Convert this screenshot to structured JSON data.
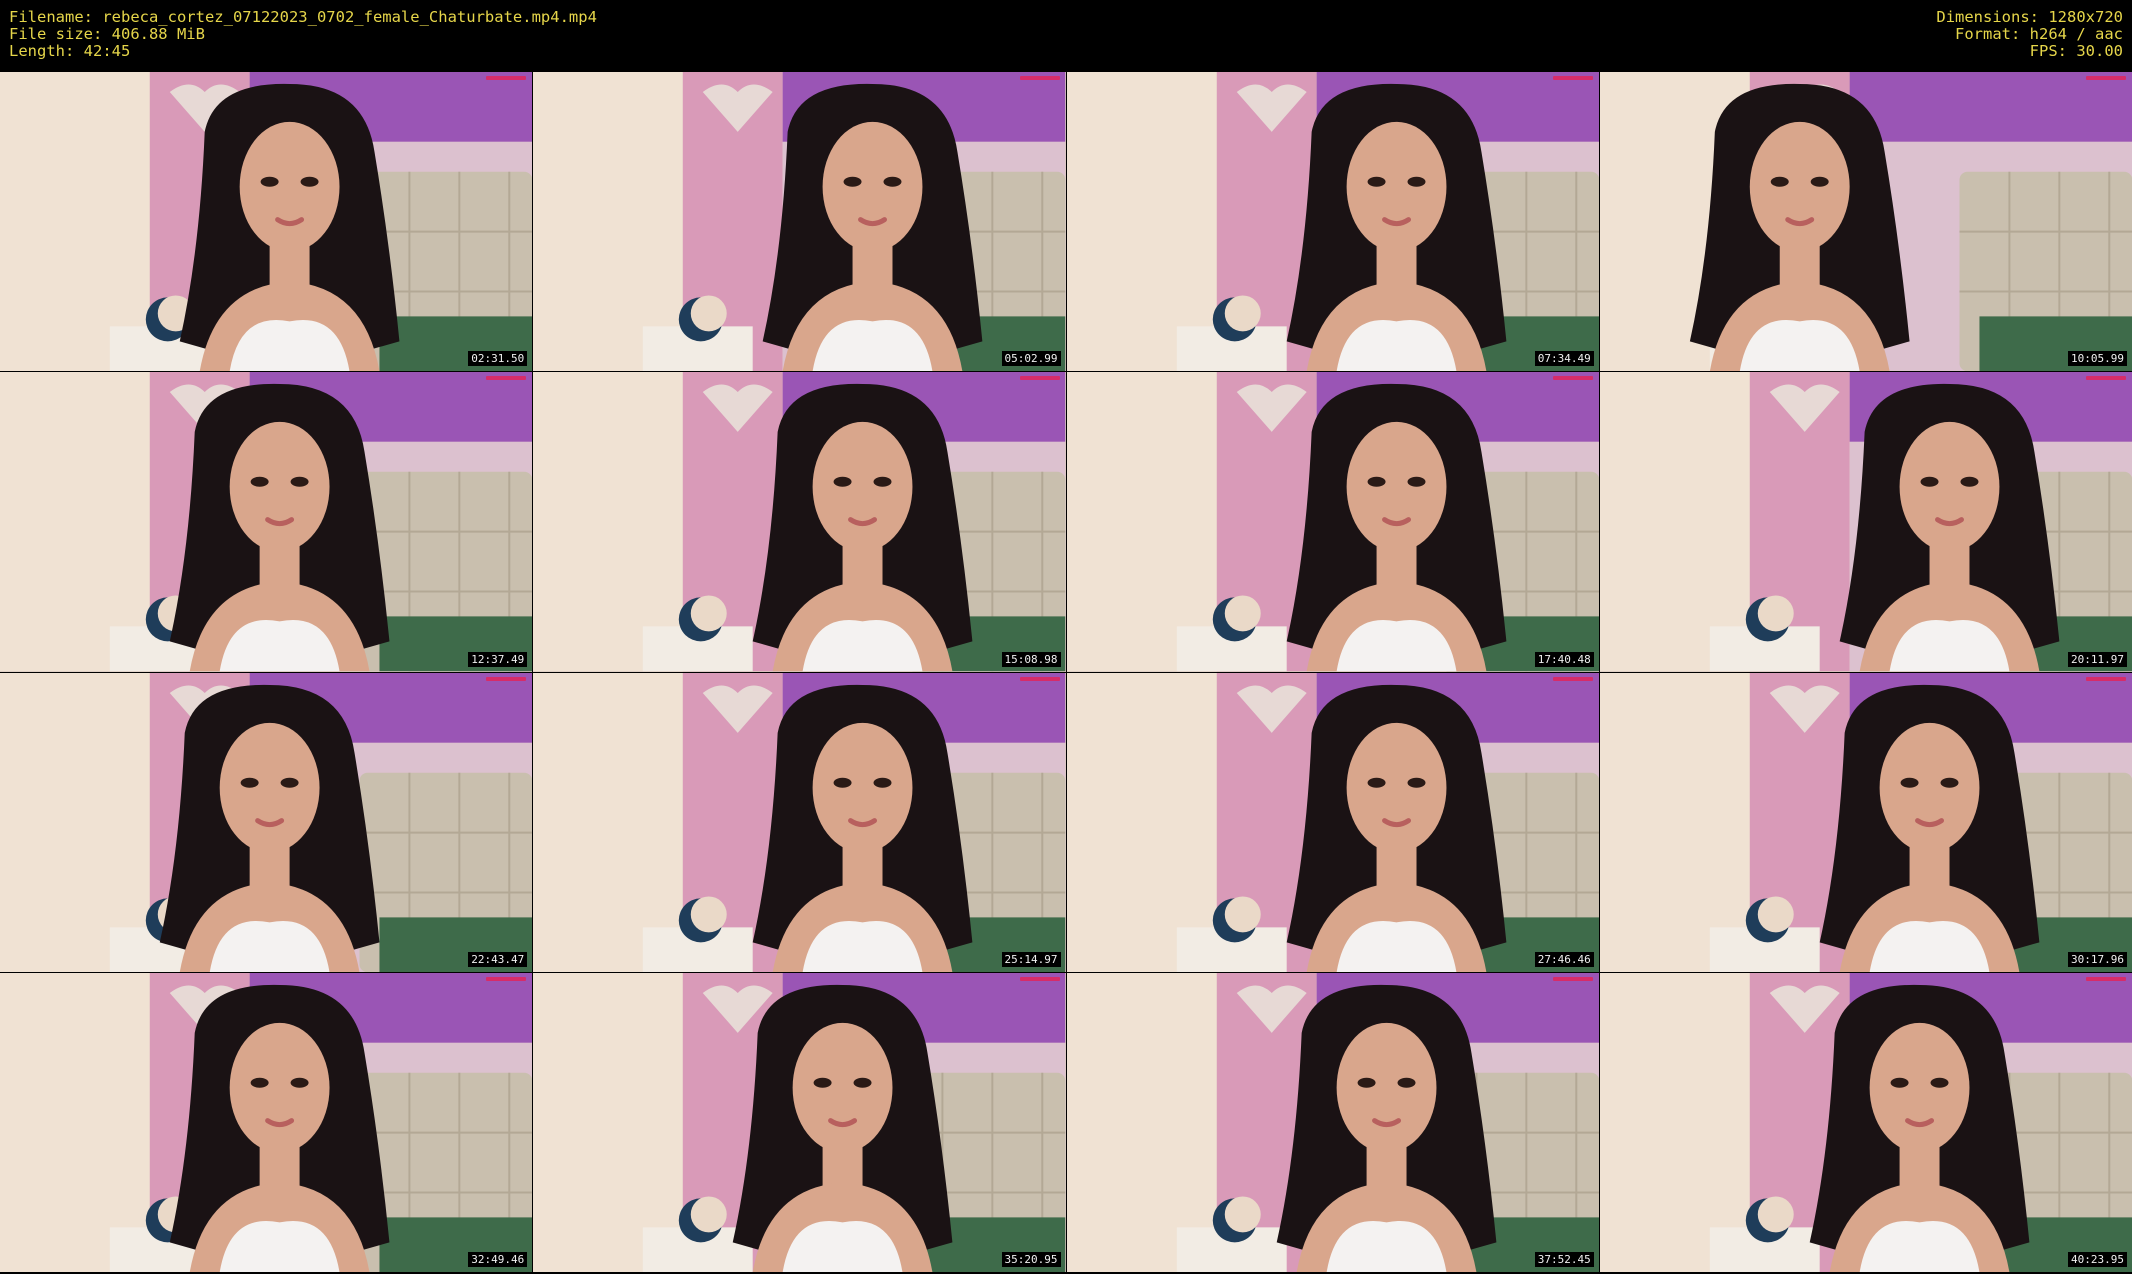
{
  "header": {
    "filename": "Filename: rebeca_cortez_07122023_0702_female_Chaturbate.mp4.mp4",
    "filesize": "File size: 406.88 MiB",
    "length": "Length: 42:45",
    "dimensions": "Dimensions: 1280x720",
    "format": "Format: h264 / aac",
    "fps": "FPS: 30.00"
  },
  "thumbnails": [
    {
      "timestamp": "02:31.50"
    },
    {
      "timestamp": "05:02.99"
    },
    {
      "timestamp": "07:34.49"
    },
    {
      "timestamp": "10:05.99"
    },
    {
      "timestamp": "12:37.49"
    },
    {
      "timestamp": "15:08.98"
    },
    {
      "timestamp": "17:40.48"
    },
    {
      "timestamp": "20:11.97"
    },
    {
      "timestamp": "22:43.47"
    },
    {
      "timestamp": "25:14.97"
    },
    {
      "timestamp": "27:46.46"
    },
    {
      "timestamp": "30:17.96"
    },
    {
      "timestamp": "32:49.46"
    },
    {
      "timestamp": "35:20.95"
    },
    {
      "timestamp": "37:52.45"
    },
    {
      "timestamp": "40:23.95"
    }
  ],
  "colors": {
    "header_text": "#e6d64a",
    "background": "#000000",
    "wall_cream": "#ead9c8",
    "wall_pink": "#d99ab8",
    "wall_purple": "#9a55b5",
    "headboard": "#c9bfae",
    "hair": "#1a1214",
    "skin": "#d9a68c",
    "top": "#f4f2f1"
  }
}
